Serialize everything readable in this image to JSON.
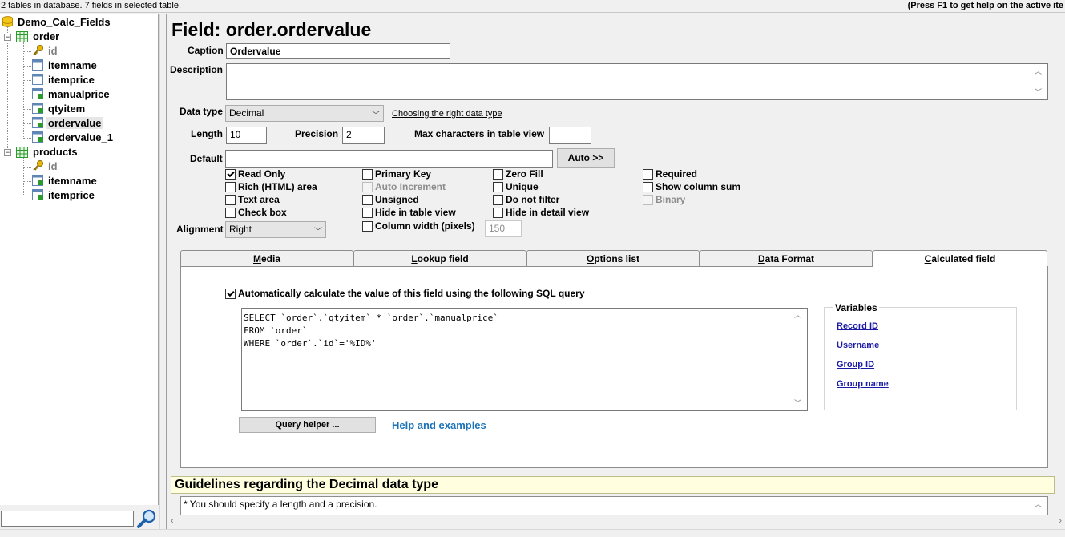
{
  "status": {
    "left": "2 tables in database. 7 fields in selected table.",
    "right": "(Press F1 to get help on the active ite"
  },
  "tree": {
    "database": "Demo_Calc_Fields",
    "tables": [
      {
        "name": "order",
        "fields": [
          "id",
          "itemname",
          "itemprice",
          "manualprice",
          "qtyitem",
          "ordervalue",
          "ordervalue_1"
        ]
      },
      {
        "name": "products",
        "fields": [
          "id",
          "itemname",
          "itemprice"
        ]
      }
    ],
    "search_value": ""
  },
  "field": {
    "title": "Field: order.ordervalue",
    "caption_label": "Caption",
    "caption_value": "Ordervalue",
    "description_label": "Description",
    "description_value": "",
    "datatype_label": "Data type",
    "datatype_value": "Decimal",
    "datatype_link": "Choosing the right data type",
    "length_label": "Length",
    "length_value": "10",
    "precision_label": "Precision",
    "precision_value": "2",
    "maxchars_label": "Max characters in table view",
    "maxchars_value": "",
    "default_label": "Default",
    "default_value": "",
    "auto_button": "Auto >>",
    "alignment_label": "Alignment",
    "alignment_value": "Right",
    "colwidth_value": "150"
  },
  "checkboxes": {
    "read_only": {
      "label": "Read Only",
      "checked": true
    },
    "rich_html": {
      "label": "Rich (HTML) area",
      "checked": false
    },
    "text_area": {
      "label": "Text area",
      "checked": false
    },
    "check_box": {
      "label": "Check box",
      "checked": false
    },
    "primary_key": {
      "label": "Primary Key",
      "checked": false
    },
    "auto_increment": {
      "label": "Auto Increment",
      "checked": false,
      "disabled": true
    },
    "unsigned": {
      "label": "Unsigned",
      "checked": false
    },
    "hide_table_view": {
      "label": "Hide in table view",
      "checked": false
    },
    "column_width": {
      "label": "Column width (pixels)",
      "checked": false
    },
    "zero_fill": {
      "label": "Zero Fill",
      "checked": false
    },
    "unique": {
      "label": "Unique",
      "checked": false
    },
    "do_not_filter": {
      "label": "Do not filter",
      "checked": false
    },
    "hide_detail_view": {
      "label": "Hide in detail view",
      "checked": false
    },
    "required": {
      "label": "Required",
      "checked": false
    },
    "show_column_sum": {
      "label": "Show column sum",
      "checked": false
    },
    "binary": {
      "label": "Binary",
      "checked": false,
      "disabled": true
    }
  },
  "tabs": [
    {
      "label": "Media",
      "ul": "M",
      "rest": "edia"
    },
    {
      "label": "Lookup field",
      "ul": "L",
      "rest": "ookup field"
    },
    {
      "label": "Options list",
      "ul": "O",
      "rest": "ptions list"
    },
    {
      "label": "Data Format",
      "ul": "D",
      "rest": "ata Format"
    },
    {
      "label": "Calculated field",
      "ul": "C",
      "rest": "alculated field",
      "active": true
    }
  ],
  "calculated": {
    "auto_calc_label": "Automatically calculate the value of this field using the following SQL query",
    "auto_calc_checked": true,
    "sql_lines": [
      "SELECT `order`.`qtyitem` * `order`.`manualprice`",
      "FROM `order`",
      "WHERE `order`.`id`='%ID%'"
    ],
    "variables_title": "Variables",
    "variables": [
      "Record ID",
      "Username",
      "Group ID",
      "Group name"
    ],
    "query_helper_button": "Query helper ...",
    "help_link": "Help and examples"
  },
  "guidelines": {
    "title": "Guidelines regarding the Decimal data type",
    "line1": "* You should specify a length and a precision."
  },
  "colors": {
    "guide_bg": "#ffffe0",
    "link": "#1a1aa6",
    "help_link": "#1a73b8"
  }
}
